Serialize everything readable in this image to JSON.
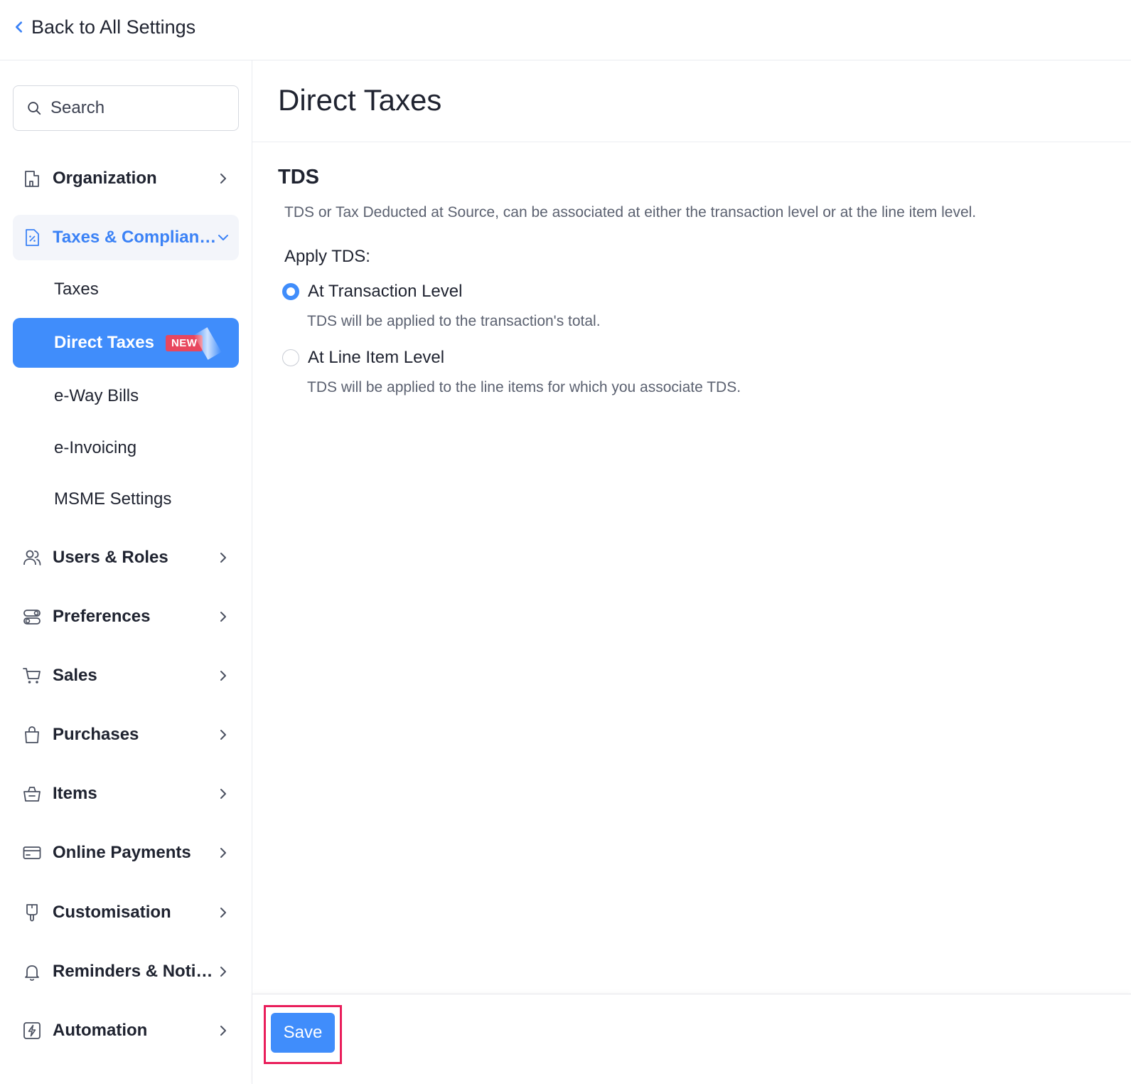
{
  "header": {
    "back_label": "Back to All Settings"
  },
  "sidebar": {
    "search_placeholder": "Search",
    "items": [
      {
        "label": "Organization",
        "icon": "building-icon"
      },
      {
        "label": "Taxes & Compliance",
        "icon": "percent-doc-icon",
        "expanded": true
      },
      {
        "label": "Users & Roles",
        "icon": "users-icon"
      },
      {
        "label": "Preferences",
        "icon": "toggles-icon"
      },
      {
        "label": "Sales",
        "icon": "cart-icon"
      },
      {
        "label": "Purchases",
        "icon": "bag-icon"
      },
      {
        "label": "Items",
        "icon": "basket-icon"
      },
      {
        "label": "Online Payments",
        "icon": "card-icon"
      },
      {
        "label": "Customisation",
        "icon": "brush-icon"
      },
      {
        "label": "Reminders & Notific...",
        "icon": "bell-icon"
      },
      {
        "label": "Automation",
        "icon": "bolt-icon"
      }
    ],
    "sub_items": [
      {
        "label": "Taxes"
      },
      {
        "label": "Direct Taxes",
        "active": true,
        "badge": "NEW"
      },
      {
        "label": "e-Way Bills"
      },
      {
        "label": "e-Invoicing"
      },
      {
        "label": "MSME Settings"
      }
    ]
  },
  "main": {
    "title": "Direct Taxes",
    "section_title": "TDS",
    "section_desc": "TDS or Tax Deducted at Source, can be associated at either the transaction level or at the line item level.",
    "apply_label": "Apply TDS:",
    "options": [
      {
        "label": "At Transaction Level",
        "hint": "TDS will be applied to the transaction's total.",
        "checked": true
      },
      {
        "label": "At Line Item Level",
        "hint": "TDS will be applied to the line items for which you associate TDS.",
        "checked": false
      }
    ]
  },
  "footer": {
    "save_label": "Save"
  },
  "colors": {
    "accent": "#408dfb",
    "highlight": "#e91e5b",
    "badge": "#e8475e"
  }
}
